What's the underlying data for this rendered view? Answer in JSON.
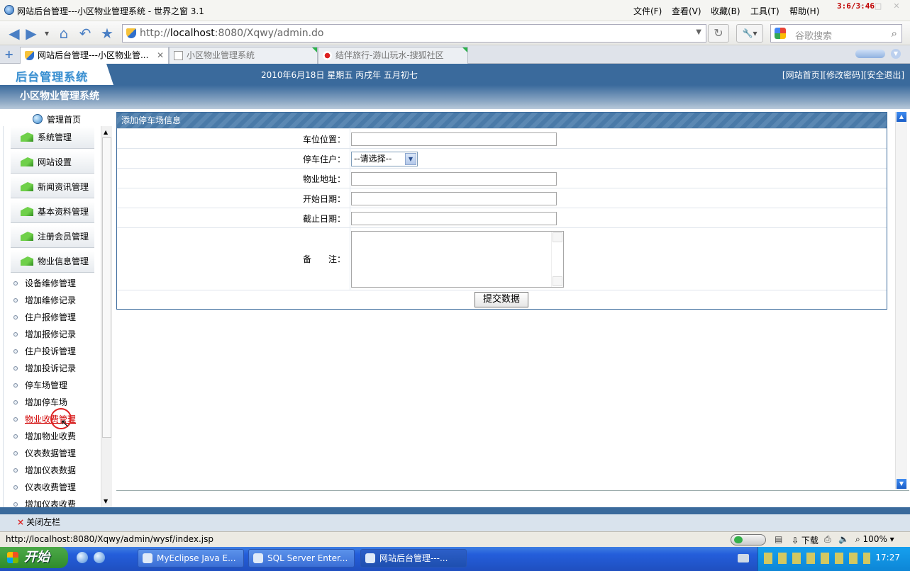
{
  "browser": {
    "window_title": "网站后台管理---小区物业管理系统 - 世界之窗 3.1",
    "clock_overlay": "3:6/3:46",
    "menu": [
      "文件(F)",
      "查看(V)",
      "收藏(B)",
      "工具(T)",
      "帮助(H)"
    ],
    "url_prefix": "http://",
    "url_host": "localhost",
    "url_rest": ":8080/Xqwy/admin.do",
    "search_placeholder": "谷歌搜索",
    "tabs": [
      {
        "label": "网站后台管理---小区物业管..."
      },
      {
        "label": "小区物业管理系统"
      },
      {
        "label": "结伴旅行-游山玩水-搜狐社区"
      }
    ],
    "status_url": "http://localhost:8080/Xqwy/admin/wysf/index.jsp",
    "download_label": "下载",
    "zoom": "100%"
  },
  "header": {
    "logo": "后台管理系统",
    "date": "2010年6月18日 星期五 丙戌年 五月初七",
    "links": "[网站首页][修改密码][安全退出]",
    "system_name": "小区物业管理系统"
  },
  "sidebar": {
    "home": "管理首页",
    "sections": [
      "系统管理",
      "网站设置",
      "新闻资讯管理",
      "基本资料管理",
      "注册会员管理",
      "物业信息管理"
    ],
    "subitems": [
      "设备维修管理",
      "增加维修记录",
      "住户报修管理",
      "增加报修记录",
      "住户投诉管理",
      "增加投诉记录",
      "停车场管理",
      "增加停车场",
      "物业收费管理",
      "增加物业收费",
      "仪表数据管理",
      "增加仪表数据",
      "仪表收费管理",
      "增加仪表收费"
    ]
  },
  "form": {
    "title": "添加停车场信息",
    "fields": {
      "location": {
        "label": "车位位置："
      },
      "resident": {
        "label": "停车住户：",
        "selected": "--请选择--"
      },
      "address": {
        "label": "物业地址："
      },
      "start_date": {
        "label": "开始日期："
      },
      "end_date": {
        "label": "截止日期："
      },
      "remark": {
        "label": "备　　注："
      }
    },
    "submit": "提交数据"
  },
  "bottombar": {
    "close_left": "关闭左栏"
  },
  "taskbar": {
    "start": "开始",
    "tasks": [
      "MyEclipse Java E...",
      "SQL Server Enter...",
      "网站后台管理---..."
    ],
    "time": "17:27"
  }
}
